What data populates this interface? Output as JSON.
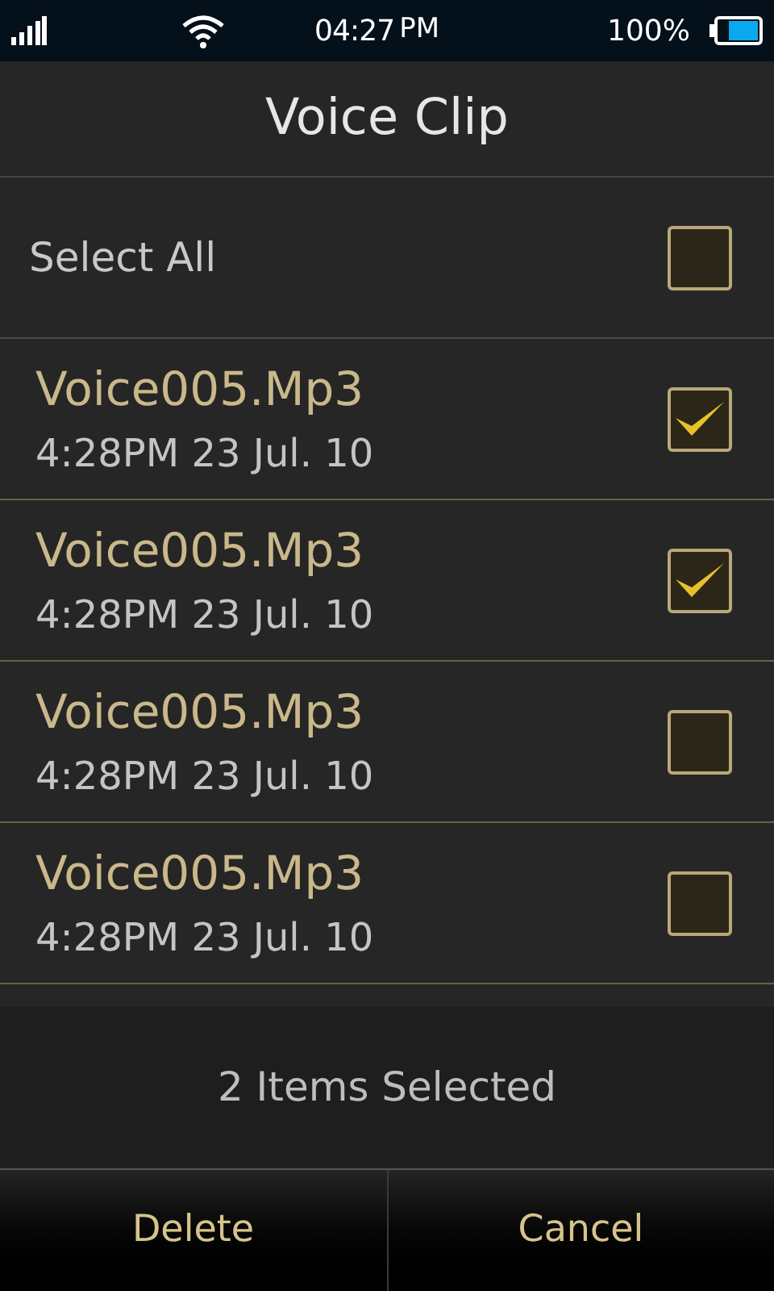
{
  "status_bar": {
    "time": "04:27",
    "ampm": "PM",
    "battery": "100%"
  },
  "title": "Voice Clip",
  "select_all": {
    "label": "Select All",
    "checked": false
  },
  "clips": [
    {
      "name": "Voice005.Mp3",
      "date": "4:28PM 23 Jul. 10",
      "checked": true
    },
    {
      "name": "Voice005.Mp3",
      "date": "4:28PM 23 Jul. 10",
      "checked": true
    },
    {
      "name": "Voice005.Mp3",
      "date": "4:28PM 23 Jul. 10",
      "checked": false
    },
    {
      "name": "Voice005.Mp3",
      "date": "4:28PM 23 Jul. 10",
      "checked": false
    }
  ],
  "selection_count": "2 Items Selected",
  "buttons": [
    "Delete",
    "Cancel"
  ]
}
